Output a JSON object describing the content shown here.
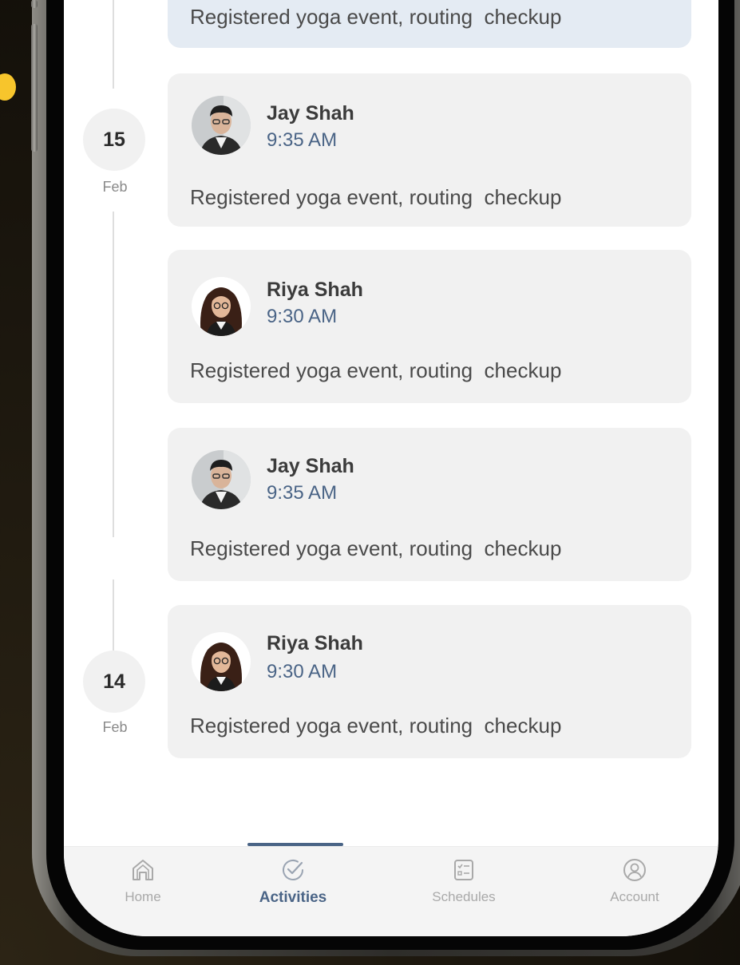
{
  "feed": {
    "top_partial_card": {
      "description": "Registered yoga event, routing  checkup"
    },
    "date_groups": [
      {
        "day": "15",
        "month": "Feb"
      },
      {
        "day": "14",
        "month": "Feb"
      }
    ],
    "cards": [
      {
        "name": "Jay Shah",
        "time": "9:35 AM",
        "description": "Registered yoga event, routing  checkup"
      },
      {
        "name": "Riya Shah",
        "time": "9:30 AM",
        "description": "Registered yoga event, routing  checkup"
      },
      {
        "name": "Jay Shah",
        "time": "9:35 AM",
        "description": "Registered yoga event, routing  checkup"
      },
      {
        "name": "Riya Shah",
        "time": "9:30 AM",
        "description": "Registered yoga event, routing  checkup"
      }
    ]
  },
  "bottom_nav": {
    "active": "Activities",
    "items": [
      {
        "label": "Home",
        "icon": "home-icon"
      },
      {
        "label": "Activities",
        "icon": "check-circle-icon"
      },
      {
        "label": "Schedules",
        "icon": "checklist-icon"
      },
      {
        "label": "Account",
        "icon": "user-circle-icon"
      }
    ]
  },
  "colors": {
    "accent": "#4a6486",
    "highlight_card": "#e4ebf3",
    "card": "#f1f1f1",
    "decor_dot": "#f7c52c"
  }
}
